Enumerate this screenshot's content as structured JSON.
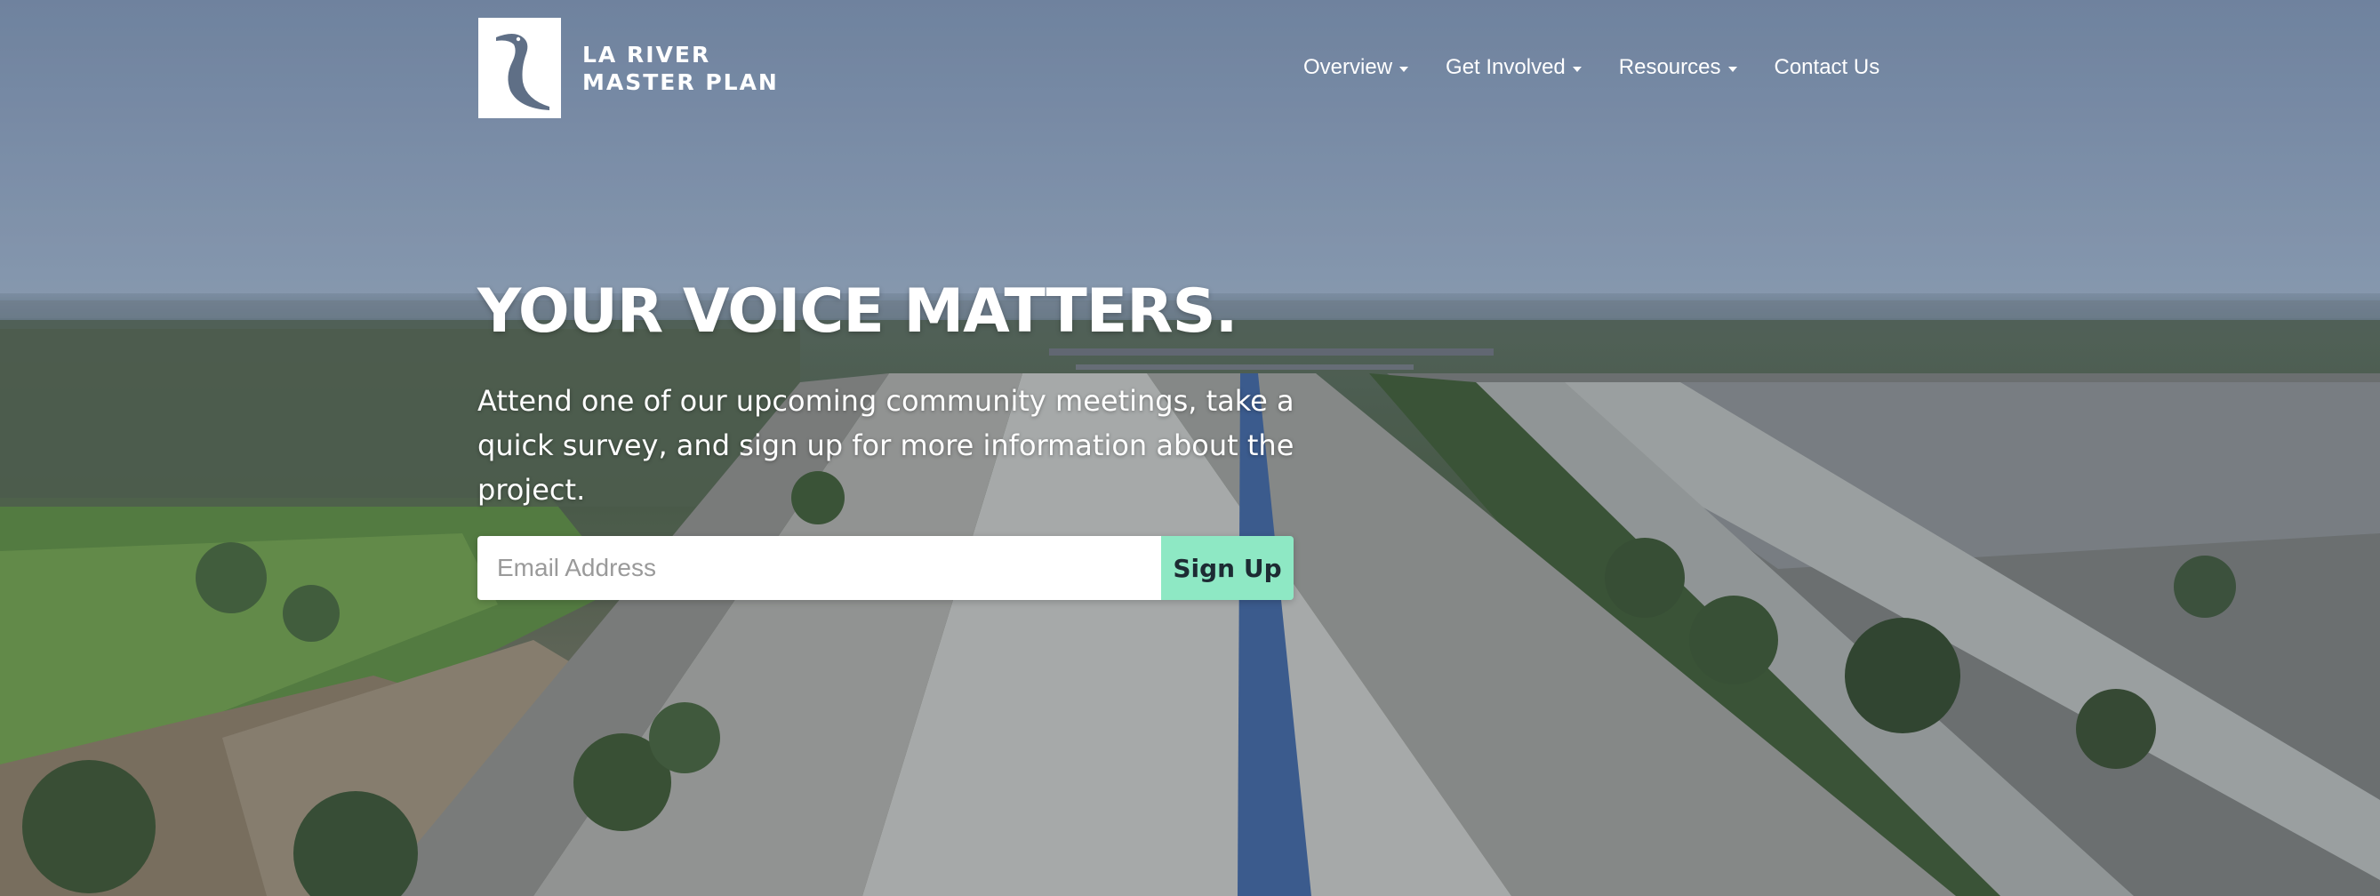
{
  "logo": {
    "line1": "LA RIVER",
    "line2": "MASTER PLAN",
    "icon": "heron-icon"
  },
  "nav": {
    "items": [
      {
        "label": "Overview",
        "dropdown": true
      },
      {
        "label": "Get Involved",
        "dropdown": true
      },
      {
        "label": "Resources",
        "dropdown": true
      },
      {
        "label": "Contact Us",
        "dropdown": false
      }
    ]
  },
  "hero": {
    "title": "YOUR VOICE MATTERS.",
    "subtitle": "Attend one of our upcoming community meetings, take a quick survey, and sign up for more information about the project."
  },
  "signup": {
    "placeholder": "Email Address",
    "value": "",
    "button_label": "Sign Up"
  },
  "colors": {
    "button_bg": "#8ee8c4",
    "text": "#ffffff"
  }
}
